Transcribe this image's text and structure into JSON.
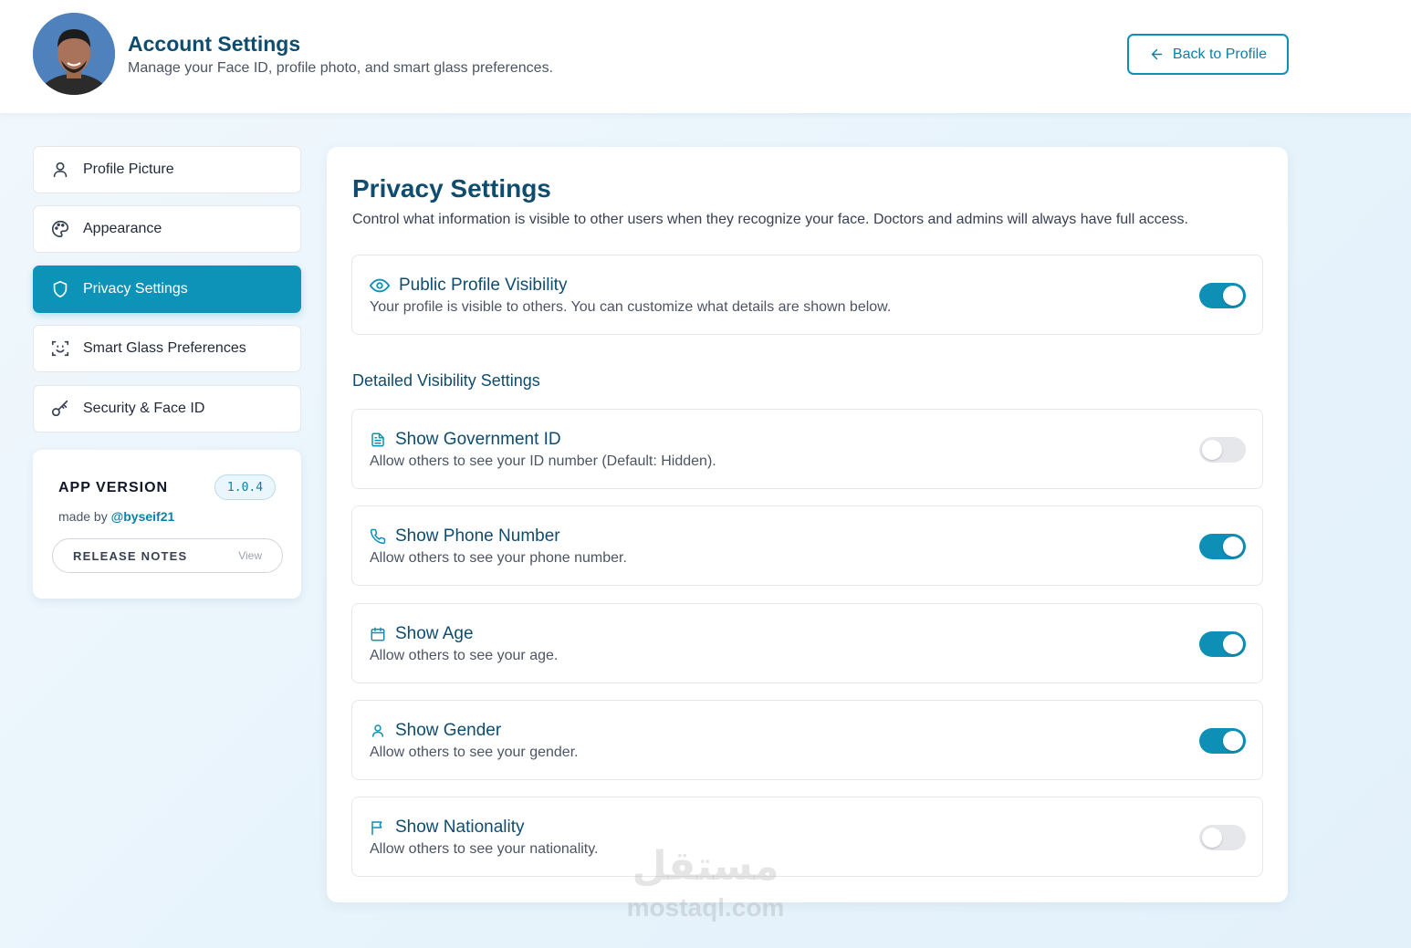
{
  "header": {
    "title": "Account Settings",
    "subtitle": "Manage your Face ID, profile photo, and smart glass preferences.",
    "back_label": "Back to Profile"
  },
  "sidebar": {
    "items": [
      {
        "label": "Profile Picture",
        "icon": "user-icon",
        "active": false
      },
      {
        "label": "Appearance",
        "icon": "palette-icon",
        "active": false
      },
      {
        "label": "Privacy Settings",
        "icon": "shield-icon",
        "active": true
      },
      {
        "label": "Smart Glass Preferences",
        "icon": "face-scan-icon",
        "active": false
      },
      {
        "label": "Security & Face ID",
        "icon": "key-icon",
        "active": false
      }
    ],
    "version_card": {
      "title": "APP VERSION",
      "version": "1.0.4",
      "made_by_prefix": "made by ",
      "made_by_handle": "@byseif21",
      "release_label": "RELEASE NOTES",
      "release_action": "View"
    }
  },
  "main": {
    "title": "Privacy Settings",
    "description": "Control what information is visible to other users when they recognize your face. Doctors and admins will always have full access.",
    "public_visibility": {
      "title": "Public Profile Visibility",
      "description": "Your profile is visible to others. You can customize what details are shown below.",
      "icon": "eye-icon",
      "enabled": true
    },
    "detailed_title": "Detailed Visibility Settings",
    "settings": [
      {
        "title": "Show Government ID",
        "description": "Allow others to see your ID number (Default: Hidden).",
        "icon": "document-icon",
        "enabled": false
      },
      {
        "title": "Show Phone Number",
        "description": "Allow others to see your phone number.",
        "icon": "phone-icon",
        "enabled": true
      },
      {
        "title": "Show Age",
        "description": "Allow others to see your age.",
        "icon": "calendar-icon",
        "enabled": true
      },
      {
        "title": "Show Gender",
        "description": "Allow others to see your gender.",
        "icon": "user-icon",
        "enabled": true
      },
      {
        "title": "Show Nationality",
        "description": "Allow others to see your nationality.",
        "icon": "flag-icon",
        "enabled": false
      }
    ]
  },
  "watermark": {
    "arabic": "مستقل",
    "latin": "mostaql.com"
  },
  "colors": {
    "accent": "#0e93b8",
    "heading": "#0f4c6e",
    "toggle_off": "#e5e7eb"
  }
}
